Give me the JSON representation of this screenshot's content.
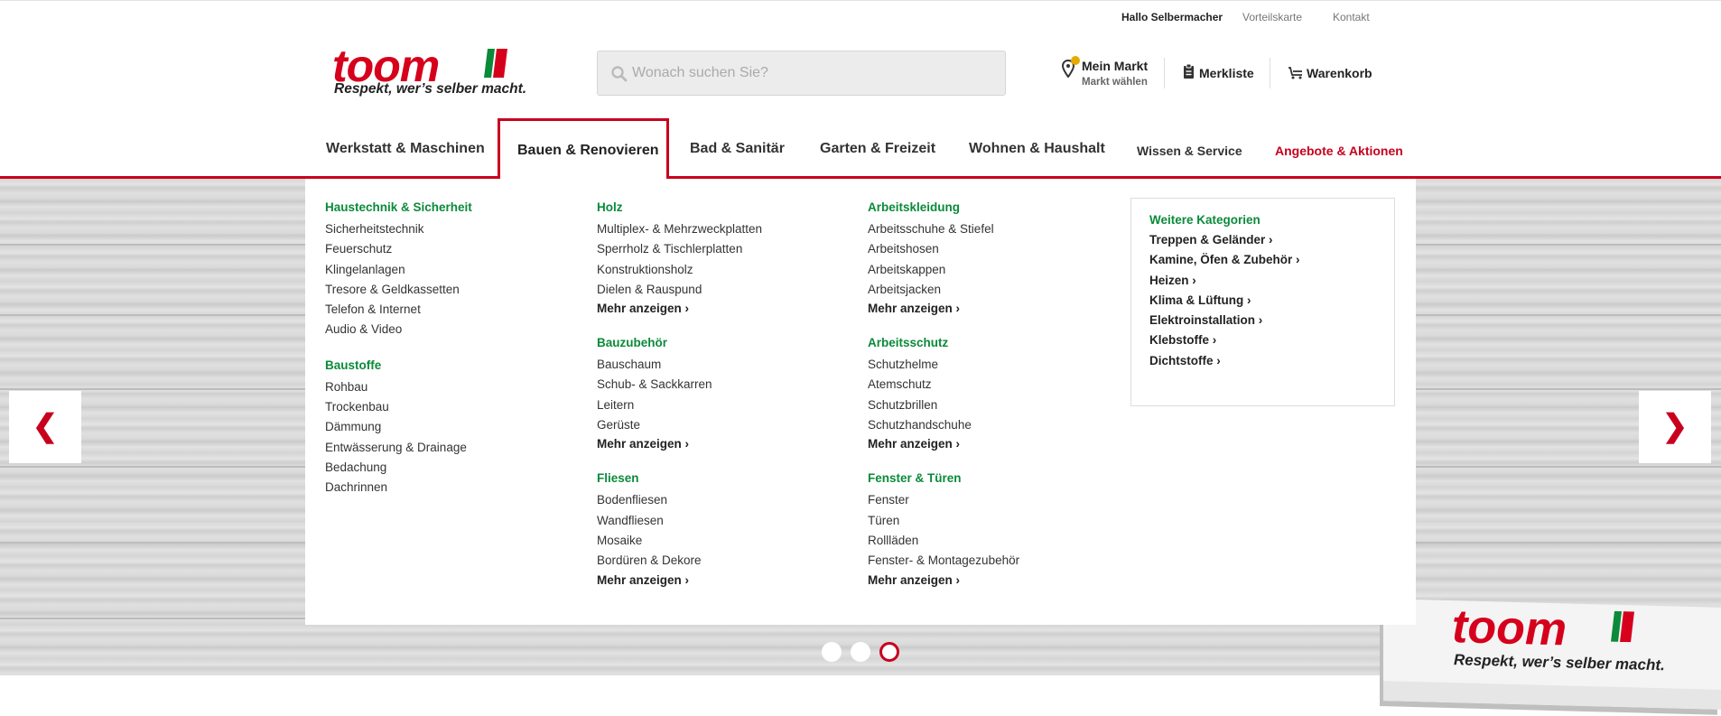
{
  "topbar": {
    "greeting": "Hallo Selbermacher",
    "vorteilskarte": "Vorteilskarte",
    "kontakt": "Kontakt"
  },
  "logo": {
    "wordmark": "toom",
    "slogan": "Respekt, wer’s selber macht."
  },
  "search": {
    "placeholder": "Wonach suchen Sie?"
  },
  "header_actions": {
    "market_label": "Mein Markt",
    "market_sub": "Markt wählen",
    "market_badge": "!",
    "merkliste": "Merkliste",
    "warenkorb": "Warenkorb"
  },
  "nav": {
    "tabs": [
      "Werkstatt & Maschinen",
      "Bauen & Renovieren",
      "Bad & Sanitär",
      "Garten & Freizeit",
      "Wohnen & Haushalt",
      "Wissen & Service",
      "Angebote & Aktionen"
    ],
    "active_tab": "Bauen & Renovieren"
  },
  "mega_menu": {
    "columns": [
      [
        {
          "title": "Haustechnik & Sicherheit",
          "items": [
            "Sicherheitstechnik",
            "Feuerschutz",
            "Klingelanlagen",
            "Tresore & Geldkassetten",
            "Telefon & Internet",
            "Audio & Video"
          ]
        },
        {
          "title": "Baustoffe",
          "items": [
            "Rohbau",
            "Trockenbau",
            "Dämmung",
            "Entwässerung & Drainage",
            "Bedachung",
            "Dachrinnen"
          ]
        }
      ],
      [
        {
          "title": "Holz",
          "items": [
            "Multiplex- & Mehrzweckplatten",
            "Sperrholz & Tischlerplatten",
            "Konstruktionsholz",
            "Dielen & Rauspund"
          ],
          "more": "Mehr anzeigen"
        },
        {
          "title": "Bauzubehör",
          "items": [
            "Bauschaum",
            "Schub- & Sackkarren",
            "Leitern",
            "Gerüste"
          ],
          "more": "Mehr anzeigen"
        },
        {
          "title": "Fliesen",
          "items": [
            "Bodenfliesen",
            "Wandfliesen",
            "Mosaike",
            "Bordüren & Dekore"
          ],
          "more": "Mehr anzeigen"
        }
      ],
      [
        {
          "title": "Arbeitskleidung",
          "items": [
            "Arbeitsschuhe & Stiefel",
            "Arbeitshosen",
            "Arbeitskappen",
            "Arbeitsjacken"
          ],
          "more": "Mehr anzeigen"
        },
        {
          "title": "Arbeitsschutz",
          "items": [
            "Schutzhelme",
            "Atemschutz",
            "Schutzbrillen",
            "Schutzhandschuhe"
          ],
          "more": "Mehr anzeigen"
        },
        {
          "title": "Fenster & Türen",
          "items": [
            "Fenster",
            "Türen",
            "Rollläden",
            "Fenster- & Montagezubehör"
          ],
          "more": "Mehr anzeigen"
        }
      ]
    ],
    "side_box": {
      "title": "Weitere Kategorien",
      "items": [
        "Treppen & Geländer",
        "Kamine, Öfen & Zubehör",
        "Heizen",
        "Klima & Lüftung",
        "Elektroinstallation",
        "Klebstoffe",
        "Dichtstoffe"
      ]
    }
  },
  "carousel": {
    "prev": "❮",
    "next": "❯",
    "slide_count": 3,
    "active_slide": 3
  },
  "colors": {
    "brand_red": "#c8001e",
    "category_green": "#0b8a3a",
    "badge_yellow": "#e8a900"
  }
}
